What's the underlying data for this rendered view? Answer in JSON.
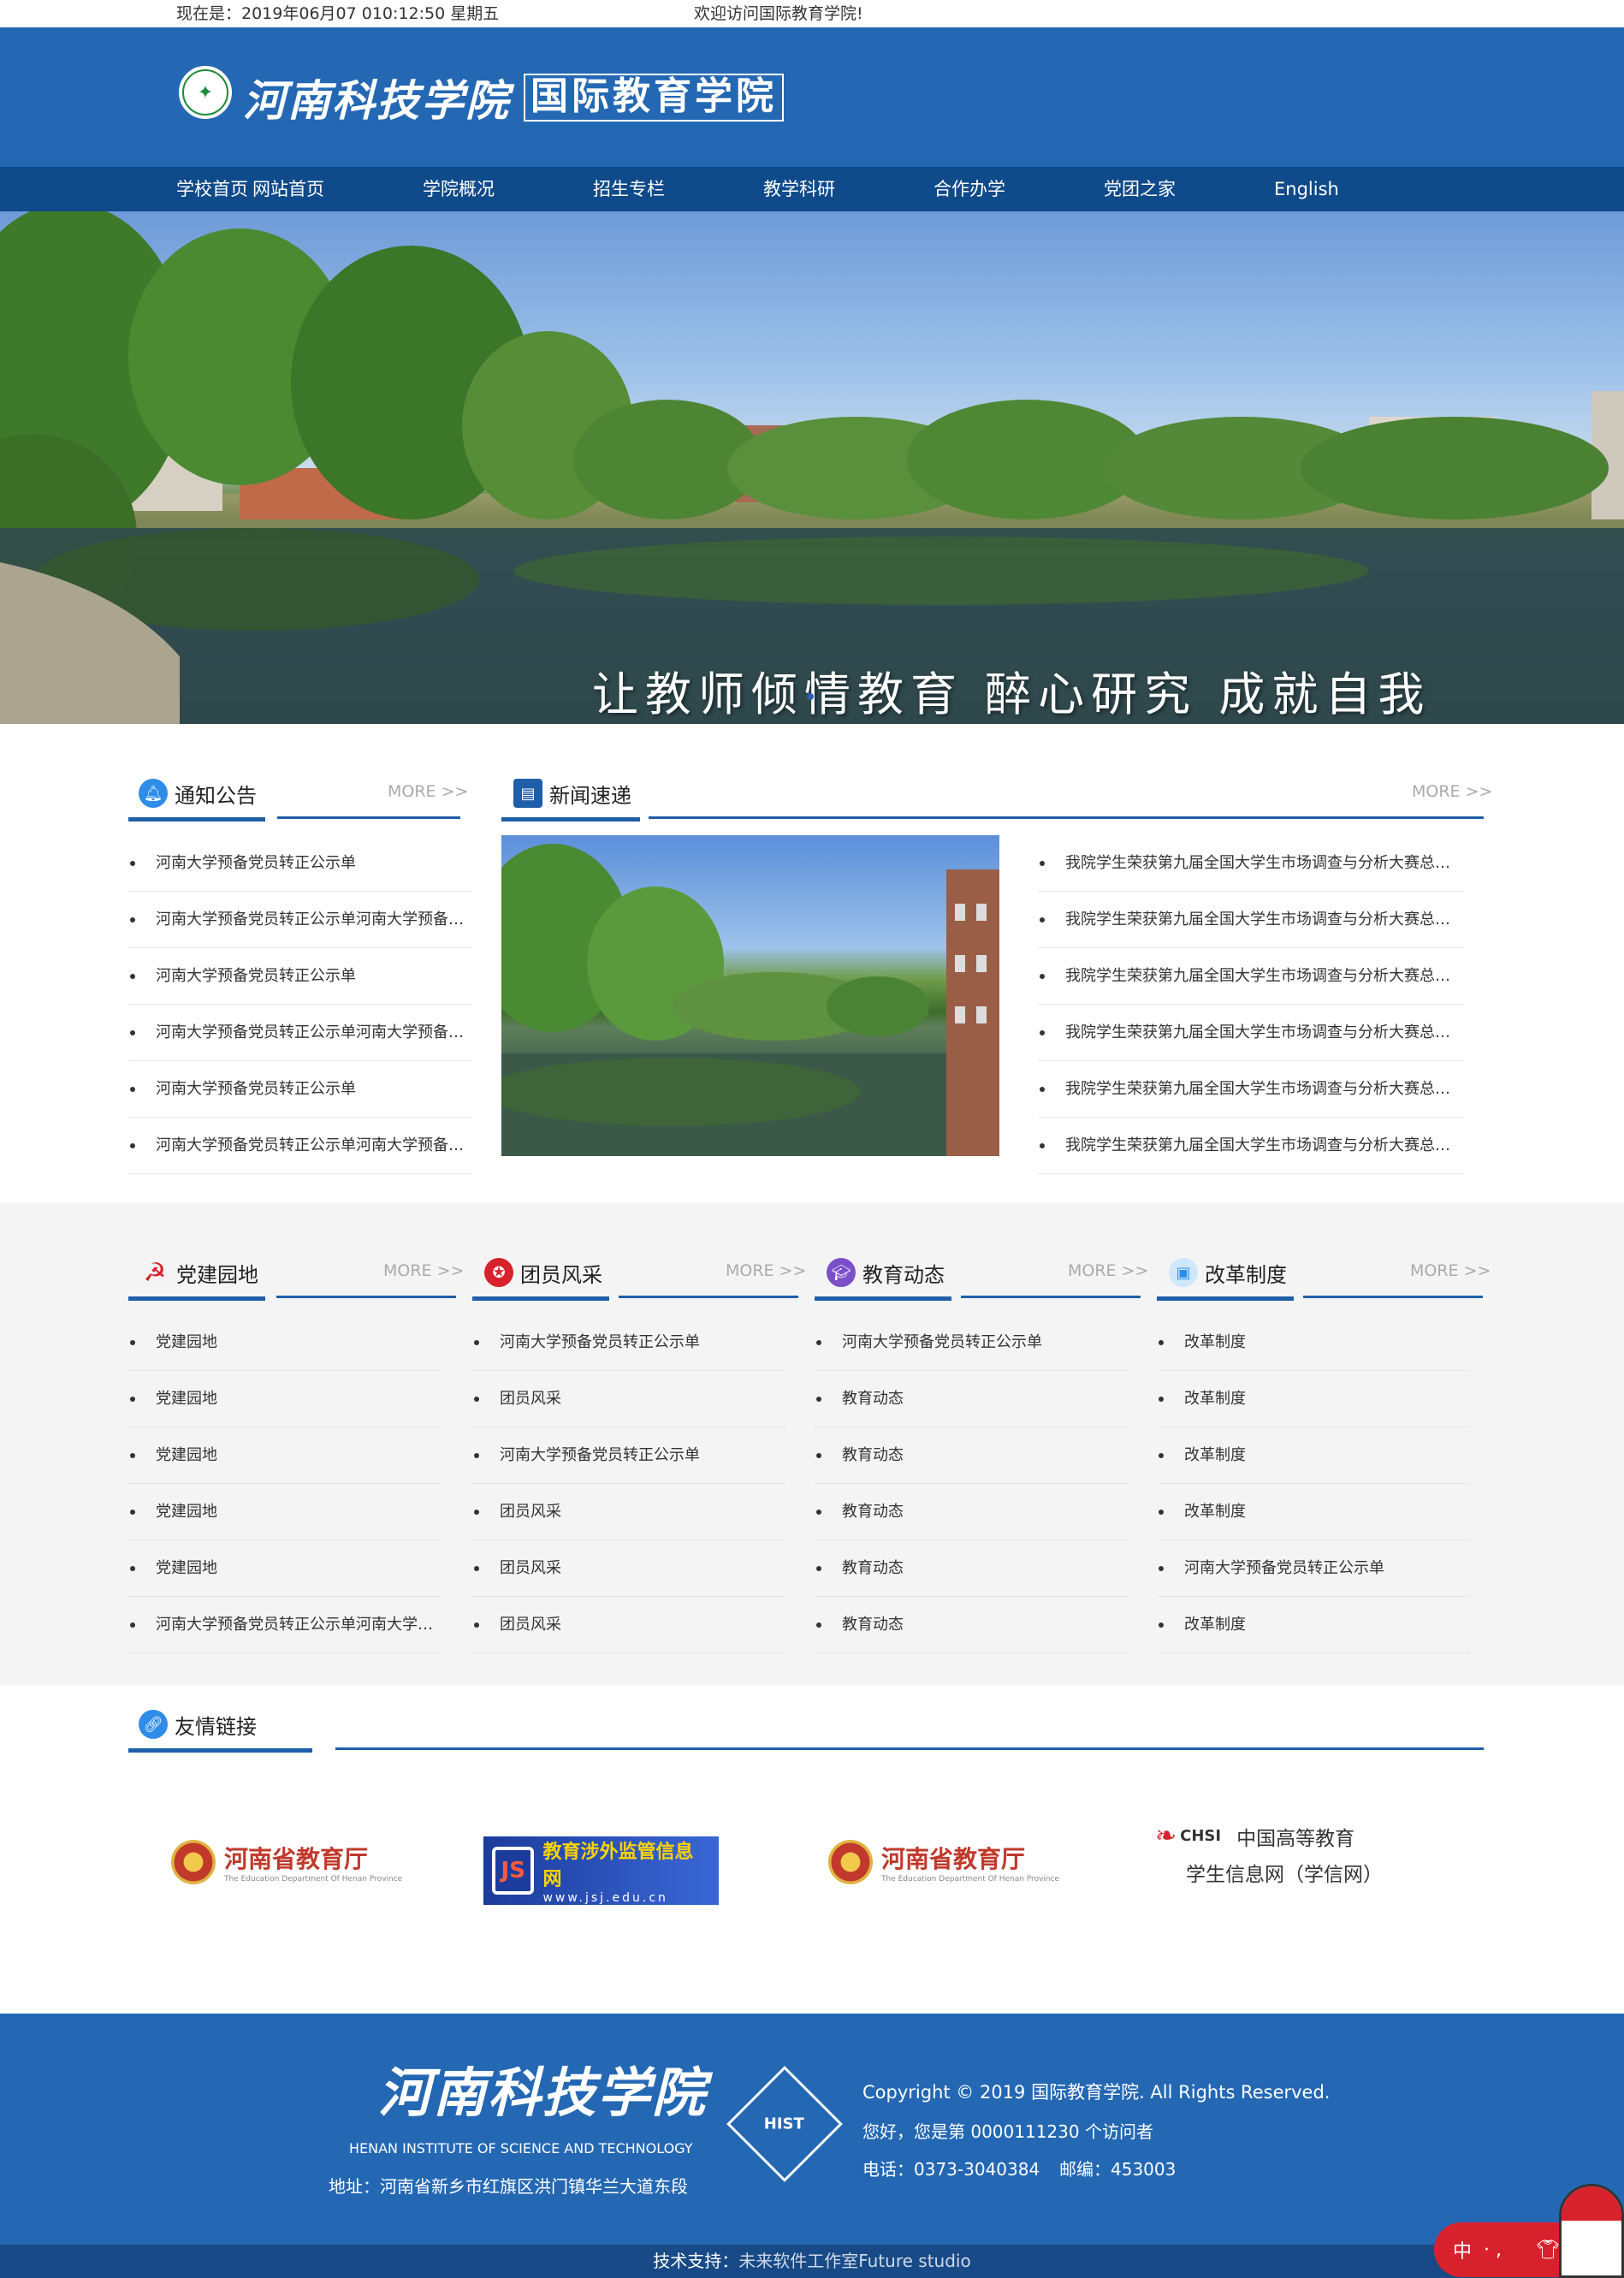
{
  "topbar": {
    "datetime": "现在是：2019年06月07 010:12:50 星期五",
    "welcome": "欢迎访问国际教育学院!"
  },
  "header": {
    "school_name": "河南科技学院",
    "college_name": "国际教育学院"
  },
  "nav": {
    "items": [
      "学校首页",
      "网站首页",
      "学院概况",
      "招生专栏",
      "教学科研",
      "合作办学",
      "党团之家",
      "English"
    ]
  },
  "banner": {
    "slogan": "让教师倾情教育 醉心研究 成就自我"
  },
  "notices": {
    "title": "通知公告",
    "more": "MORE >>",
    "items": [
      "河南大学预备党员转正公示单",
      "河南大学预备党员转正公示单河南大学预备党...",
      "河南大学预备党员转正公示单",
      "河南大学预备党员转正公示单河南大学预备党...",
      "河南大学预备党员转正公示单",
      "河南大学预备党员转正公示单河南大学预备党..."
    ]
  },
  "news": {
    "title": "新闻速递",
    "more": "MORE >>",
    "items": [
      "我院学生荣获第九届全国大学生市场调查与分析大赛总决...",
      "我院学生荣获第九届全国大学生市场调查与分析大赛总决...",
      "我院学生荣获第九届全国大学生市场调查与分析大赛总决...",
      "我院学生荣获第九届全国大学生市场调查与分析大赛总决...",
      "我院学生荣获第九届全国大学生市场调查与分析大赛总决...",
      "我院学生荣获第九届全国大学生市场调查与分析大赛总决..."
    ]
  },
  "columns": [
    {
      "title": "党建园地",
      "more": "MORE >>",
      "icon": "party-icon",
      "color": "#d7212c",
      "items": [
        "党建园地",
        "党建园地",
        "党建园地",
        "党建园地",
        "党建园地",
        "河南大学预备党员转正公示单河南大学预..."
      ]
    },
    {
      "title": "团员风采",
      "more": "MORE >>",
      "icon": "league-icon",
      "color": "#d7212c",
      "items": [
        "河南大学预备党员转正公示单",
        "团员风采",
        "河南大学预备党员转正公示单",
        "团员风采",
        "团员风采",
        "团员风采"
      ]
    },
    {
      "title": "教育动态",
      "more": "MORE >>",
      "icon": "graduation-cap-icon",
      "color": "#7b4fc9",
      "items": [
        "河南大学预备党员转正公示单",
        "教育动态",
        "教育动态",
        "教育动态",
        "教育动态",
        "教育动态"
      ]
    },
    {
      "title": "改革制度",
      "more": "MORE >>",
      "icon": "document-icon",
      "color": "#3aa0e6",
      "items": [
        "改革制度",
        "改革制度",
        "改革制度",
        "改革制度",
        "河南大学预备党员转正公示单",
        "改革制度"
      ]
    }
  ],
  "links": {
    "title": "友情链接",
    "logos": [
      {
        "name": "河南省教育厅",
        "sub": "The Education Department Of Henan Province"
      },
      {
        "name": "教育涉外监管信息网",
        "sub": "www.jsj.edu.cn"
      },
      {
        "name": "河南省教育厅",
        "sub": "The Education Department Of Henan Province"
      },
      {
        "name": "中国高等教育",
        "name2": "学生信息网（学信网）",
        "sub": "CHSI"
      }
    ]
  },
  "footer": {
    "school_name": "河南科技学院",
    "school_en": "HENAN INSTITUTE OF SCIENCE AND TECHNOLOGY",
    "address": "地址：河南省新乡市红旗区洪门镇华兰大道东段",
    "seal_text": "HIST",
    "copyright": "Copyright © 2019 国际教育学院. All Rights Reserved.",
    "visitors": "您好，您是第 0000111230 个访问者",
    "phone": "电话：0373-3040384",
    "postcode": "邮编：453003",
    "tech_label": "技术支持：",
    "tech_value": "未来软件工作室Future studio"
  },
  "lang_toggle": {
    "label": "中",
    "dots": "· ,"
  }
}
